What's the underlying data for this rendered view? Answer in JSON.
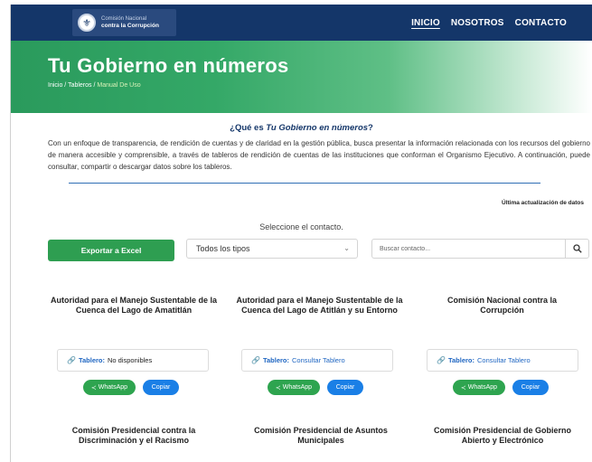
{
  "nav": {
    "logo_line1": "Comisión Nacional",
    "logo_line2": "contra la Corrupción",
    "items": [
      {
        "label": "INICIO",
        "active": true
      },
      {
        "label": "NOSOTROS",
        "active": false
      },
      {
        "label": "CONTACTO",
        "active": false
      }
    ]
  },
  "hero": {
    "title": "Tu Gobierno en números",
    "breadcrumb": [
      "Inicio",
      "Tableros",
      "Manual De Uso"
    ],
    "breadcrumb_sep": " / "
  },
  "intro": {
    "title_prefix": "¿Qué es ",
    "title_em": "Tu Gobierno en números",
    "title_suffix": "?",
    "body": "Con un enfoque de transparencia, de rendición de cuentas y de claridad en la gestión pública, busca presentar la información relacionada con los recursos del gobierno de manera accesible y comprensible, a través de tableros de rendición de cuentas de las instituciones que conforman el Organismo Ejecutivo. A continuación, puede consultar, compartir o descargar datos sobre los tableros."
  },
  "last_updated": "Última actualización de datos",
  "select_label": "Seleccione el contacto.",
  "controls": {
    "export_label": "Exportar a Excel",
    "type_select_value": "Todos los tipos",
    "search_placeholder": "Buscar contacto..."
  },
  "cards": [
    {
      "title": "Autoridad para el Manejo Sustentable de la Cuenca del Lago de Amatitlán",
      "tablero_label": "Tablero:",
      "tablero_value": "No disponibles",
      "link": false
    },
    {
      "title": "Autoridad para el Manejo Sustentable de la Cuenca del Lago de Atitlán y su Entorno",
      "tablero_label": "Tablero:",
      "tablero_value": "Consultar Tablero",
      "link": true
    },
    {
      "title": "Comisión Nacional contra la Corrupción",
      "tablero_label": "Tablero:",
      "tablero_value": "Consultar Tablero",
      "link": true
    },
    {
      "title": "Comisión Presidencial contra la Discriminación y el Racismo"
    },
    {
      "title": "Comisión Presidencial de Asuntos Municipales"
    },
    {
      "title": "Comisión Presidencial de Gobierno Abierto y Electrónico"
    }
  ],
  "card_actions": {
    "whatsapp": "WhatsApp",
    "copy": "Copiar"
  },
  "colors": {
    "nav": "#143669",
    "green": "#2e9e51",
    "blue": "#1a7fe6",
    "link": "#1f66c2"
  }
}
